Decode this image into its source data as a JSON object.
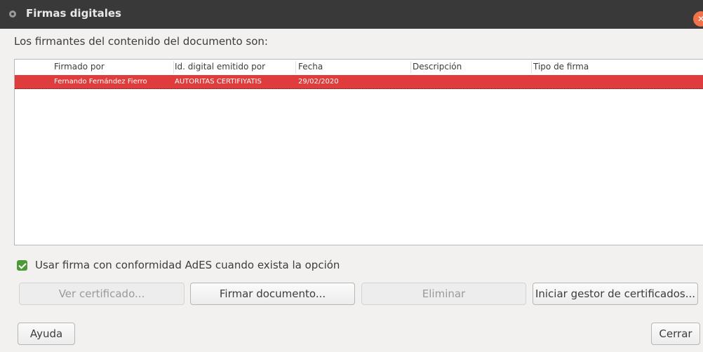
{
  "window": {
    "title": "Firmas digitales",
    "close_icon": "close-icon"
  },
  "intro_text": "Los firmantes del contenido del documento son:",
  "table": {
    "columns": [
      "Firmado por",
      "Id. digital emitido por",
      "Fecha",
      "Descripción",
      "Tipo de firma"
    ],
    "rows": [
      {
        "firmado_por": "Fernando Fernández Fierro",
        "emitido_por": "AUTORITAS CERTIFIYATIS",
        "fecha": "29/02/2020",
        "descripcion": "",
        "tipo": ""
      }
    ],
    "selected_row_color": "#df3d3d"
  },
  "option": {
    "label": "Usar firma con conformidad AdES cuando exista la opción",
    "checked": true,
    "check_color": "#4e9a3a"
  },
  "buttons": {
    "ver_certificado": "Ver certificado...",
    "firmar_documento": "Firmar documento...",
    "eliminar": "Eliminar",
    "iniciar_gestor": "Iniciar gestor de certificados...",
    "ayuda": "Ayuda",
    "cerrar": "Cerrar"
  }
}
